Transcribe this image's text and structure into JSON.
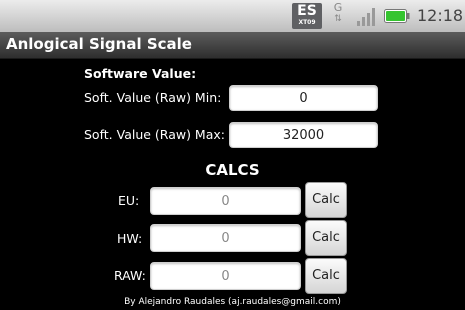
{
  "status_bar": {
    "app_badge": "ES",
    "app_badge_sub": "XT09",
    "network_type": "G",
    "time": "12:18",
    "colors": {
      "battery": "#35c430"
    }
  },
  "app": {
    "title": "Anlogical Signal Scale"
  },
  "software": {
    "section_label": "Software Value:",
    "min_label": "Soft. Value (Raw) Min:",
    "min_value": "0",
    "max_label": "Soft. Value (Raw) Max:",
    "max_value": "32000"
  },
  "calcs": {
    "heading": "CALCS",
    "rows": [
      {
        "label": "EU:",
        "value": "0",
        "button": "Calc"
      },
      {
        "label": "HW:",
        "value": "0",
        "button": "Calc"
      },
      {
        "label": "RAW:",
        "value": "0",
        "button": "Calc"
      }
    ]
  },
  "footer": {
    "credit": "By Alejandro Raudales (aj.raudales@gmail.com)"
  }
}
